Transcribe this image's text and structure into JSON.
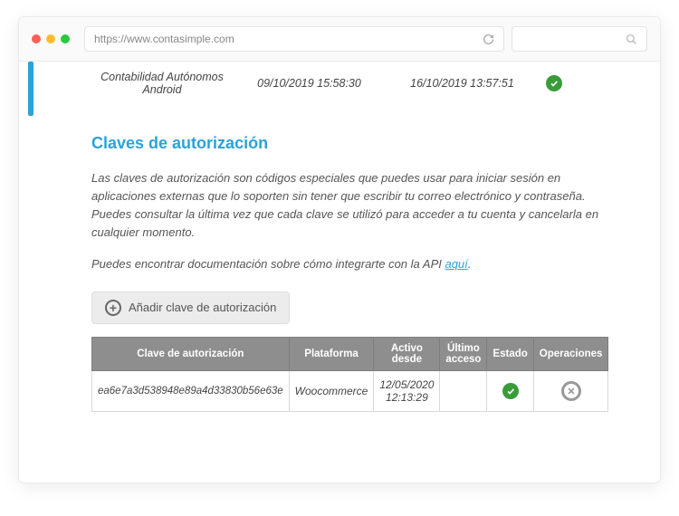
{
  "browser": {
    "url": "https://www.contasimple.com"
  },
  "top_row": {
    "app_name": "Contabilidad Autónomos Android",
    "created": "09/10/2019 15:58:30",
    "last_access": "16/10/2019 13:57:51"
  },
  "section": {
    "title": "Claves de autorización",
    "desc1": "Las claves de autorización son códigos especiales que puedes usar para iniciar sesión en aplicaciones externas que lo soporten sin tener que escribir tu correo electrónico y contraseña. Puedes consultar la última vez que cada clave se utilizó para acceder a tu cuenta y cancelarla en cualquier momento.",
    "desc2_pre": "Puedes encontrar documentación sobre cómo integrarte con la API ",
    "desc2_link": "aquí",
    "desc2_post": ".",
    "add_button": "Añadir clave de autorización"
  },
  "table": {
    "headers": {
      "key": "Clave de autorización",
      "platform": "Plataforma",
      "active_since": "Activo desde",
      "last_access": "Último acceso",
      "status": "Estado",
      "ops": "Operaciones"
    },
    "rows": [
      {
        "key": "ea6e7a3d538948e89a4d33830b56e63e",
        "platform": "Woocommerce",
        "active_since": "12/05/2020 12:13:29",
        "last_access": "",
        "status_ok": true
      }
    ]
  }
}
